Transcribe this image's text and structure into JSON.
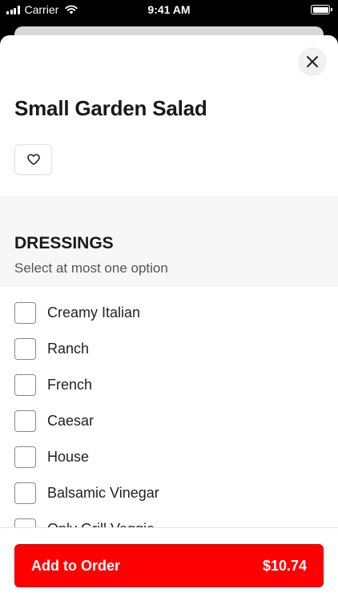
{
  "status_bar": {
    "carrier": "Carrier",
    "time": "9:41 AM"
  },
  "item": {
    "title": "Small Garden Salad"
  },
  "section": {
    "title": "DRESSINGS",
    "subtitle": "Select at most one option"
  },
  "options": [
    {
      "label": "Creamy Italian",
      "checked": false
    },
    {
      "label": "Ranch",
      "checked": false
    },
    {
      "label": "French",
      "checked": false
    },
    {
      "label": "Caesar",
      "checked": false
    },
    {
      "label": "House",
      "checked": false
    },
    {
      "label": "Balsamic Vinegar",
      "checked": false
    },
    {
      "label": "Only Grill Veggie",
      "checked": false
    }
  ],
  "footer": {
    "add_label": "Add to Order",
    "price": "$10.74"
  },
  "colors": {
    "accent": "#ff0000"
  }
}
